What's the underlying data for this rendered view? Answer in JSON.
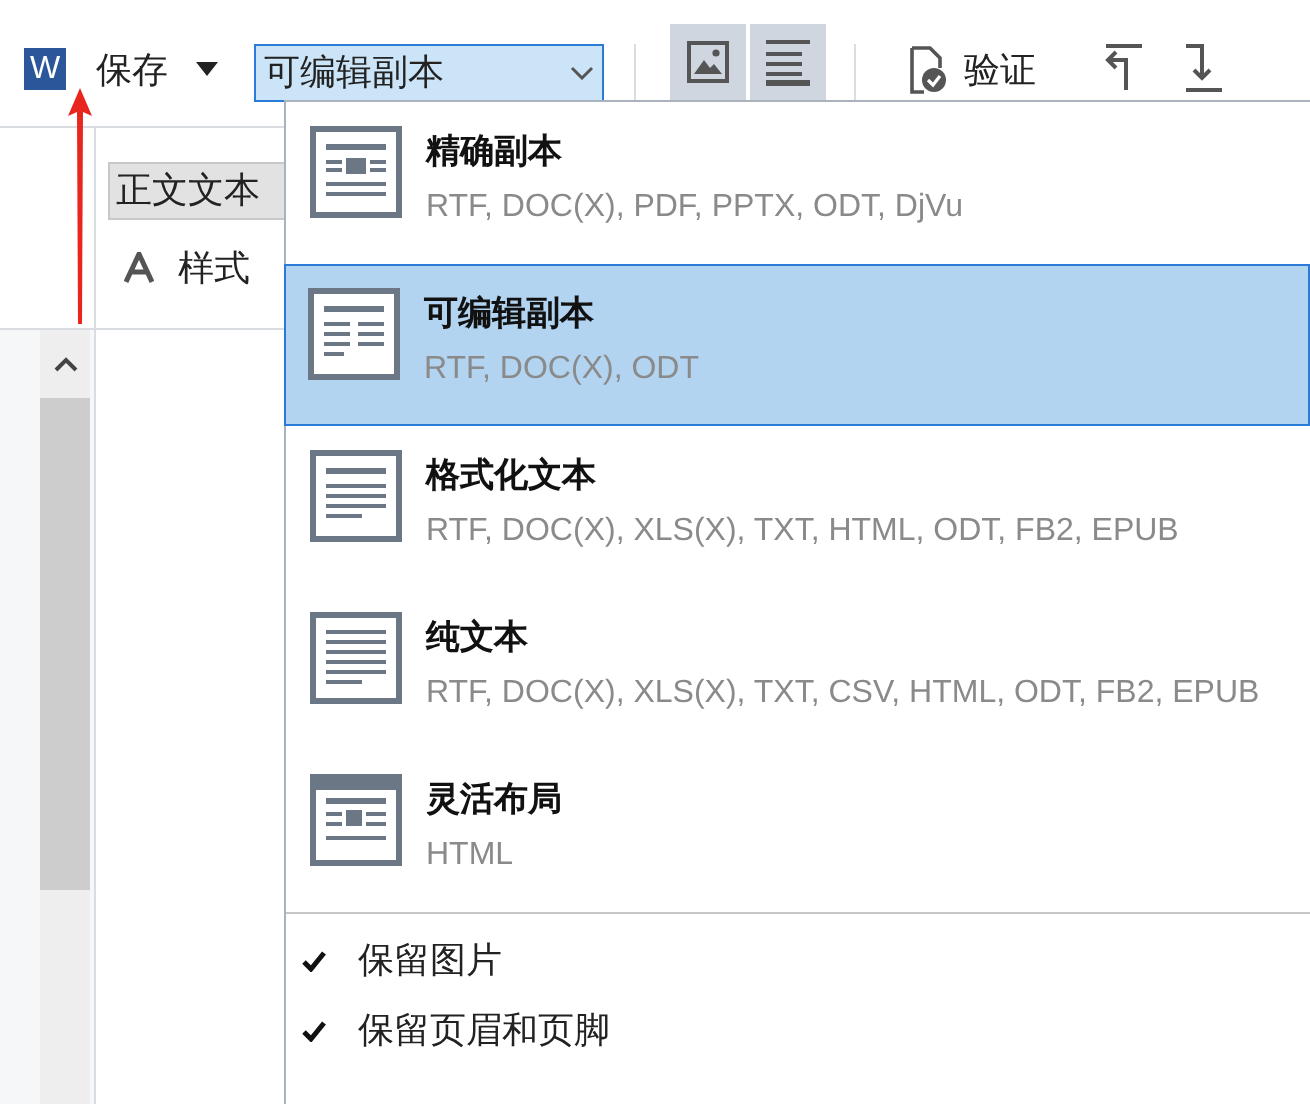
{
  "toolbar": {
    "app_icon": "W",
    "save": "保存",
    "format_select": {
      "value": "可编辑副本"
    },
    "view_toggles": [
      {
        "kind": "image",
        "selected": true
      },
      {
        "kind": "text",
        "selected": true
      }
    ],
    "verify": "验证"
  },
  "side_panel": {
    "style_select": {
      "value": "正文文本"
    },
    "styles_label": "样式"
  },
  "format_menu": {
    "items": [
      {
        "kind": "exact",
        "title": "精确副本",
        "formats": "RTF, DOC(X), PDF, PPTX, ODT, DjVu",
        "selected": false
      },
      {
        "kind": "editable",
        "title": "可编辑副本",
        "formats": "RTF, DOC(X), ODT",
        "selected": true
      },
      {
        "kind": "formatted",
        "title": "格式化文本",
        "formats": "RTF, DOC(X), XLS(X), TXT, HTML, ODT, FB2, EPUB",
        "selected": false
      },
      {
        "kind": "plain",
        "title": "纯文本",
        "formats": "RTF, DOC(X), XLS(X), TXT, CSV, HTML, ODT, FB2, EPUB",
        "selected": false
      },
      {
        "kind": "flexible",
        "title": "灵活布局",
        "formats": "HTML",
        "selected": false
      }
    ],
    "options": [
      {
        "label": "保留图片",
        "checked": true
      },
      {
        "label": "保留页眉和页脚",
        "checked": true
      }
    ]
  }
}
